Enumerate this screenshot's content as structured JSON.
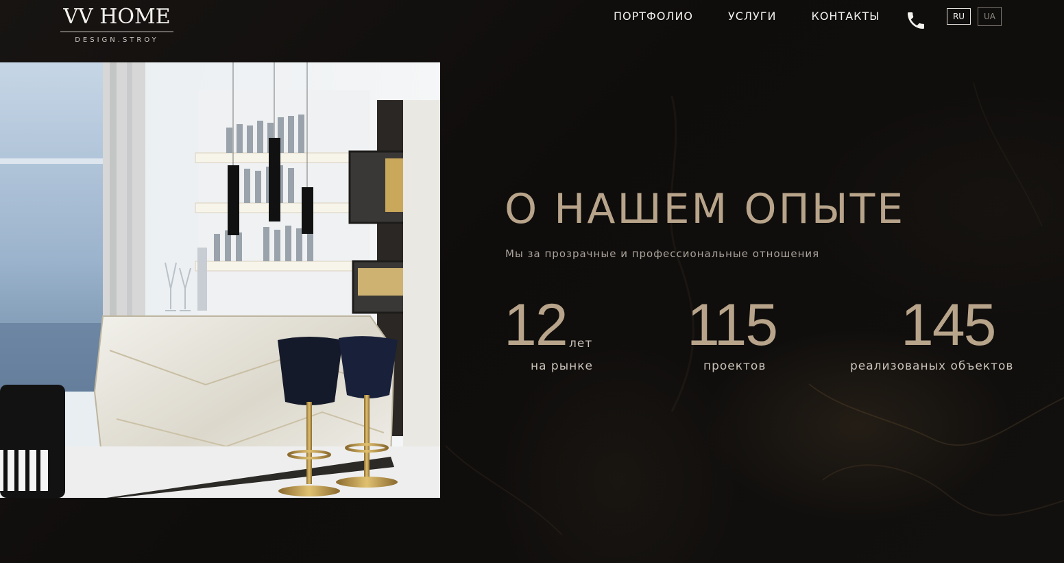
{
  "header": {
    "logo_main": "VV HOME",
    "logo_sub": "DESIGN.STROY",
    "nav": [
      {
        "label": "ПОРТФОЛИО"
      },
      {
        "label": "УСЛУГИ"
      },
      {
        "label": "КОНТАКТЫ"
      }
    ],
    "phone_icon": "phone-icon",
    "languages": [
      {
        "label": "RU",
        "active": true
      },
      {
        "label": "UA",
        "active": false
      }
    ]
  },
  "about": {
    "title": "О НАШЕМ ОПЫТЕ",
    "subtitle": "Мы за прозрачные и профессиональные отношения",
    "stats": [
      {
        "value": "12",
        "unit": "лет",
        "label": "на рынке"
      },
      {
        "value": "115",
        "label": "проектов"
      },
      {
        "value": "145",
        "label": "реализованых объектов"
      }
    ]
  },
  "colors": {
    "background": "#0e0c0b",
    "accent_gold": "#b8a48a",
    "text_light": "#f3f1ee"
  }
}
